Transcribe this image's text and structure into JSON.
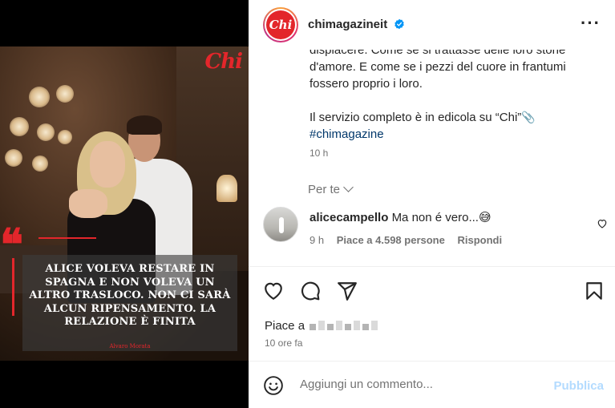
{
  "post": {
    "brand_logo": "Chi",
    "quote_text": "ALICE VOLEVA RESTARE IN SPAGNA E NON VOLEVA UN ALTRO TRASLOCO. NON CI SARÀ ALCUN RIPENSAMENTO. LA RELAZIONE È FINITA",
    "quote_author": "Alvaro Morata"
  },
  "header": {
    "avatar_text": "Chi",
    "username": "chimagazineit",
    "more_icon": "more-horizontal-icon"
  },
  "caption": {
    "partial_top": "dispiacere. Come se si trattasse delle loro storie d'amore. E come se i pezzi del cuore in frantumi fossero proprio i loro.",
    "line2": "Il servizio completo è in edicola su “Chi”",
    "hashtag": "#chimagazine",
    "time": "10 h"
  },
  "filter": {
    "label": "Per te"
  },
  "comment": {
    "username": "alicecampello",
    "text": "Ma non é vero...😅",
    "time": "9 h",
    "likes": "Piace a 4.598 persone",
    "reply": "Rispondi"
  },
  "likes": {
    "prefix": "Piace a"
  },
  "post_time": "10 ore fa",
  "composer": {
    "placeholder": "Aggiungi un commento...",
    "publish": "Pubblica"
  },
  "colors": {
    "brand_red": "#e3262b",
    "link_blue": "#00376b",
    "muted": "#737373",
    "publish_disabled": "#b3dbff"
  }
}
